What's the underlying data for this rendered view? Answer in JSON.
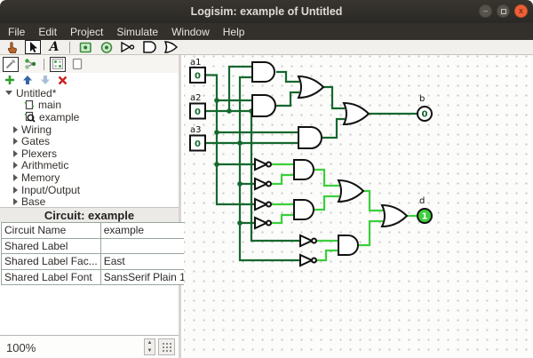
{
  "window": {
    "title": "Logisim: example of Untitled",
    "controls": {
      "minimize": "–",
      "maximize": "maximize",
      "close": "x"
    }
  },
  "menu": {
    "items": [
      "File",
      "Edit",
      "Project",
      "Simulate",
      "Window",
      "Help"
    ]
  },
  "toolbar": {
    "text_tool_label": "A",
    "tools": [
      "poke-tool",
      "edit-tool",
      "text-tool",
      "input-pin-tool",
      "output-pin-tool",
      "not-gate-tool",
      "and-gate-tool",
      "or-gate-tool"
    ],
    "selected_tool": "edit-tool"
  },
  "explorer": {
    "toolbar_icons": [
      "toolbox-icon",
      "simulation-tree-icon",
      "layout-icon",
      "appearance-icon"
    ],
    "action_icons": [
      "add-circuit-icon",
      "move-up-icon",
      "move-down-icon",
      "remove-circuit-icon"
    ],
    "tree": {
      "root": "Untitled*",
      "circuits": [
        {
          "label": "main"
        },
        {
          "label": "example",
          "current": true
        }
      ],
      "libraries": [
        "Wiring",
        "Gates",
        "Plexers",
        "Arithmetic",
        "Memory",
        "Input/Output",
        "Base"
      ]
    }
  },
  "attributes": {
    "header": "Circuit: example",
    "rows": [
      {
        "name": "Circuit Name",
        "value": "example"
      },
      {
        "name": "Shared Label",
        "value": ""
      },
      {
        "name": "Shared Label Fac...",
        "value": "East"
      },
      {
        "name": "Shared Label Font",
        "value": "SansSerif Plain 12"
      }
    ]
  },
  "zoom": {
    "value": "100%"
  },
  "canvas": {
    "inputs": [
      {
        "label": "a1",
        "value": "0"
      },
      {
        "label": "a2",
        "value": "0"
      },
      {
        "label": "a3",
        "value": "0"
      }
    ],
    "outputs": [
      {
        "label": "b",
        "value": "0"
      },
      {
        "label": "d",
        "value": "1"
      }
    ],
    "gates": [
      "and-gate-1",
      "and-gate-2",
      "and-gate-3",
      "or-gate-1",
      "or-gate-b",
      "not-gate-1",
      "not-gate-2",
      "not-gate-3",
      "not-gate-4",
      "not-gate-5",
      "not-gate-6",
      "and-gate-4",
      "and-gate-5",
      "and-gate-6",
      "or-gate-2",
      "or-gate-3"
    ],
    "colors": {
      "wire_low": "#15682e",
      "wire_high": "#3ccf3c"
    }
  }
}
